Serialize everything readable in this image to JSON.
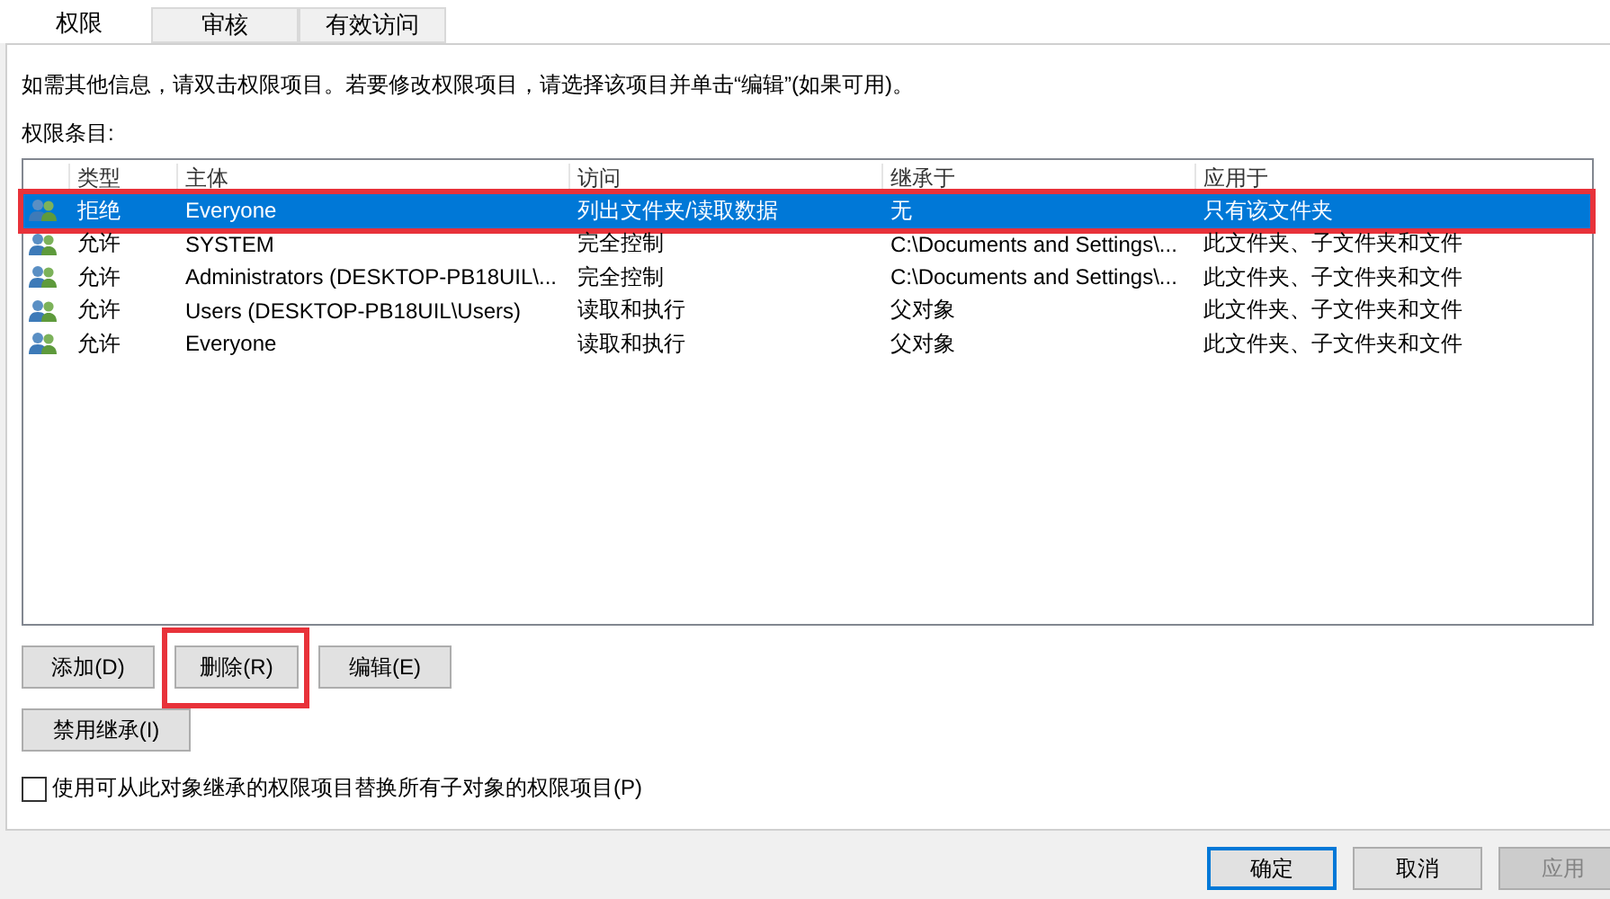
{
  "tabs": [
    {
      "label": "权限",
      "selected": true
    },
    {
      "label": "审核",
      "selected": false
    },
    {
      "label": "有效访问",
      "selected": false
    }
  ],
  "info_text": "如需其他信息，请双击权限项目。若要修改权限项目，请选择该项目并单击“编辑”(如果可用)。",
  "list_label": "权限条目:",
  "table": {
    "columns": [
      "类型",
      "主体",
      "访问",
      "继承于",
      "应用于"
    ],
    "rows": [
      {
        "cells": [
          "拒绝",
          "Everyone",
          "列出文件夹/读取数据",
          "无",
          "只有该文件夹"
        ],
        "selected": true,
        "highlighted": true
      },
      {
        "cells": [
          "允许",
          "SYSTEM",
          "完全控制",
          "C:\\Documents and Settings\\...",
          "此文件夹、子文件夹和文件"
        ],
        "selected": false,
        "highlighted": false
      },
      {
        "cells": [
          "允许",
          "Administrators (DESKTOP-PB18UIL\\...",
          "完全控制",
          "C:\\Documents and Settings\\...",
          "此文件夹、子文件夹和文件"
        ],
        "selected": false,
        "highlighted": false
      },
      {
        "cells": [
          "允许",
          "Users (DESKTOP-PB18UIL\\Users)",
          "读取和执行",
          "父对象",
          "此文件夹、子文件夹和文件"
        ],
        "selected": false,
        "highlighted": false
      },
      {
        "cells": [
          "允许",
          "Everyone",
          "读取和执行",
          "父对象",
          "此文件夹、子文件夹和文件"
        ],
        "selected": false,
        "highlighted": false
      }
    ]
  },
  "entry_buttons": [
    {
      "label": "添加(D)",
      "highlighted": false
    },
    {
      "label": "删除(R)",
      "highlighted": true
    },
    {
      "label": "编辑(E)",
      "highlighted": false
    }
  ],
  "inherit_button": "禁用继承(I)",
  "replace_checkbox": {
    "label": "使用可从此对象继承的权限项目替换所有子对象的权限项目(P)",
    "checked": false
  },
  "dialog_buttons": [
    {
      "label": "确定",
      "disabled": false,
      "default": true
    },
    {
      "label": "取消",
      "disabled": false,
      "default": false
    },
    {
      "label": "应用",
      "disabled": true,
      "default": false
    }
  ]
}
